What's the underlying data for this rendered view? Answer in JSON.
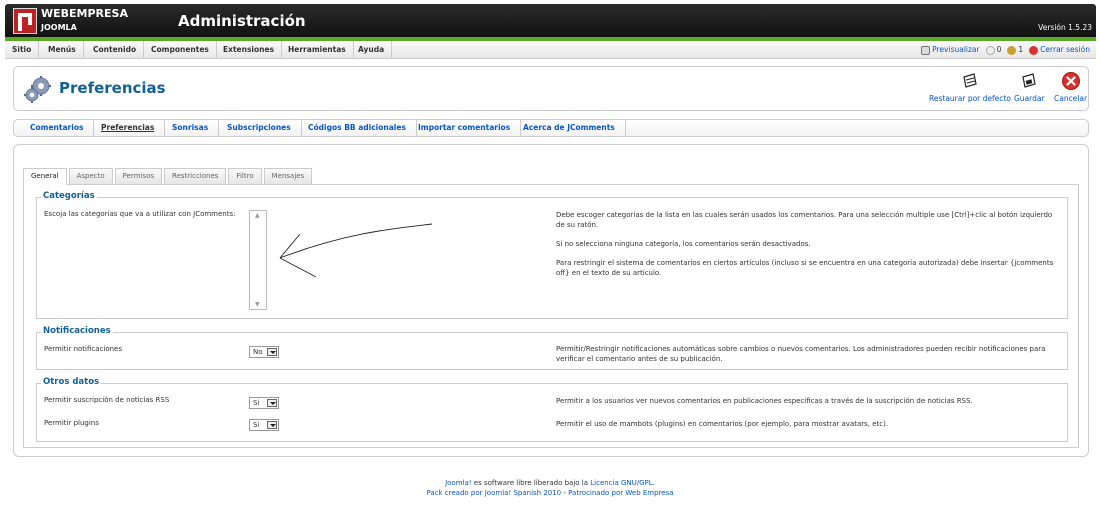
{
  "header": {
    "brand": "WEBEMPRESA",
    "brand_sub": "JOOMLA",
    "title": "Administración",
    "version": "Versión 1.5.23"
  },
  "menu": {
    "items": [
      "Sitio",
      "Menús",
      "Contenido",
      "Componentes",
      "Extensiones",
      "Herramientas",
      "Ayuda"
    ],
    "preview": "Previsualizar",
    "messages_count": "0",
    "users_count": "1",
    "logout": "Cerrar sesión"
  },
  "toolbar": {
    "page_title": "Preferencias",
    "restore_label": "Restaurar por defecto",
    "save_label": "Guardar",
    "cancel_label": "Cancelar"
  },
  "submenu": {
    "items": [
      "Comentarios",
      "Preferencias",
      "Sonrisas",
      "Subscripciones",
      "Códigos BB adicionales",
      "Importar comentarios",
      "Acerca de JComments"
    ],
    "active": "Preferencias"
  },
  "tabs": {
    "items": [
      "General",
      "Aspecto",
      "Permisos",
      "Restricciones",
      "Filtro",
      "Mensajes"
    ],
    "active": "General"
  },
  "categorias": {
    "legend": "Categorías",
    "label": "Escoja las categorías que va a utilizar con JComments:",
    "desc1": "Debe escoger categorías de la lista en las cuales serán usados los comentarios. Para una selección multiple use [Ctrl]+clic al botón izquierdo de su ratón.",
    "desc2": "Si no selecciona ninguna categoría, los comentarios serán desactivados.",
    "desc3": "Para restringir el sistema de comentarios en ciertos artículos (incluso si se encuentra en una categoría autorizada) debe insertar {jcomments off} en el texto de su artículo."
  },
  "notificaciones": {
    "legend": "Notificaciones",
    "label": "Permitir notificaciones",
    "value": "No",
    "desc": "Permitir/Restringir notificaciones automáticas sobre cambios o nuevos comentarios. Los administradores pueden recibir notificaciones para verificar el comentario antes de su publicación."
  },
  "otros": {
    "legend": "Otros datos",
    "rss_label": "Permitir suscripción de noticias RSS",
    "rss_value": "Si",
    "rss_desc": "Permitir a los usuarios ver nuevos comentarios en publicaciones especificas a través de la suscripción de noticias RSS.",
    "plugins_label": "Permitir plugins",
    "plugins_value": "Si",
    "plugins_desc": "Permitir el uso de mambots (plugins) en comentarios (por ejemplo, para mostrar avatars, etc)."
  },
  "footer": {
    "line1_link1": "Joomla!",
    "line1_text": " es software libre liberado bajo la ",
    "line1_link2": "Licencia GNU/GPL",
    "line1_end": ".",
    "line2_link1": "Pack creado por Joomla! Spanish 2010",
    "line2_sep": " - ",
    "line2_link2": "Patrocinado por Web Empresa"
  },
  "colors": {
    "accent": "#146295",
    "link": "#0b55c4",
    "green": "#5aa825"
  }
}
